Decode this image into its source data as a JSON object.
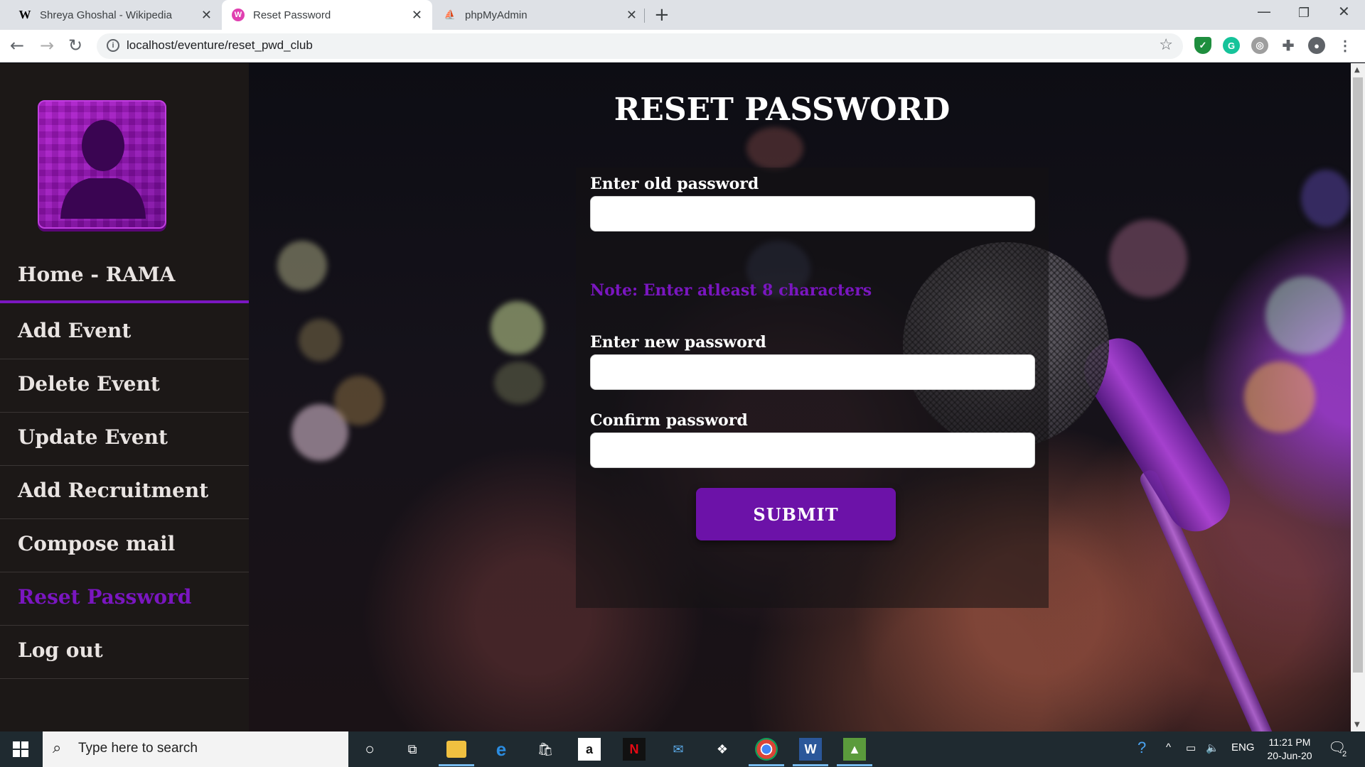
{
  "browser": {
    "tabs": [
      {
        "title": "Shreya Ghoshal - Wikipedia",
        "favicon": "W"
      },
      {
        "title": "Reset Password",
        "favicon": "W"
      },
      {
        "title": "phpMyAdmin",
        "favicon": "pma"
      }
    ],
    "active_tab": 1,
    "url": "localhost/eventure/reset_pwd_club",
    "extensions": [
      "shield-icon",
      "grammarly-icon",
      "circle-ext-icon",
      "puzzle-icon",
      "profile-icon"
    ]
  },
  "sidebar": {
    "items": [
      {
        "label": "Home - RAMA"
      },
      {
        "label": "Add Event"
      },
      {
        "label": "Delete Event"
      },
      {
        "label": "Update Event"
      },
      {
        "label": "Add Recruitment"
      },
      {
        "label": "Compose mail"
      },
      {
        "label": "Reset Password"
      },
      {
        "label": "Log out"
      }
    ],
    "active_index": 6
  },
  "main": {
    "title": "RESET PASSWORD",
    "form": {
      "old_password_label": "Enter old password",
      "old_password_value": "",
      "note": "Note: Enter atleast 8 characters",
      "new_password_label": "Enter new password",
      "new_password_value": "",
      "confirm_password_label": "Confirm password",
      "confirm_password_value": "",
      "submit_label": "SUBMIT"
    }
  },
  "colors": {
    "accent": "#7a16c0",
    "button": "#6c12a8",
    "sidebar_bg": "#1c1817"
  },
  "taskbar": {
    "search_placeholder": "Type here to search",
    "language": "ENG",
    "time": "11:21 PM",
    "date": "20-Jun-20",
    "notification_count": "2"
  }
}
